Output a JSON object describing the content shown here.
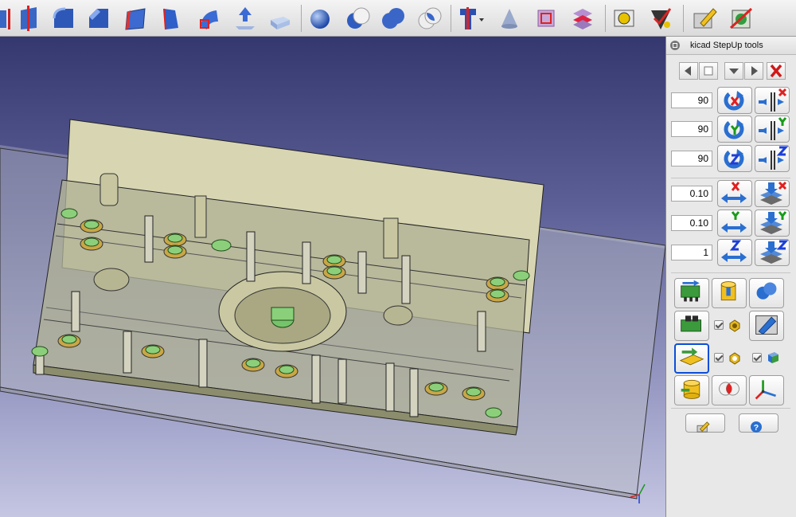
{
  "toolbar": {
    "icons": [
      "mirror-icon",
      "section-icon",
      "fillet-icon",
      "chamfer-icon",
      "face-icon",
      "ruled-surface-icon",
      "loft-icon",
      "extrude-icon",
      "box-icon",
      "sphere-icon",
      "boolean-cut-icon",
      "boolean-union-icon",
      "boolean-intersect-icon",
      "part-design-icon",
      "cone-icon",
      "cross-section-icon",
      "slices-icon",
      "measure-icon",
      "checker-icon",
      "sketch-edit-icon",
      "hide-icon"
    ]
  },
  "panel": {
    "title": "kicad StepUp tools",
    "rotation": {
      "x_angle": "90",
      "y_angle": "90",
      "z_angle": "90"
    },
    "translation": {
      "x_step": "0.10",
      "y_step": "0.10",
      "z_step": "1"
    },
    "colors": {
      "x_axis": "#e02020",
      "y_axis": "#1a9a1a",
      "z_axis": "#1c3fd6",
      "rotate_arrow": "#2a6fd0",
      "close": "#d01818"
    }
  }
}
